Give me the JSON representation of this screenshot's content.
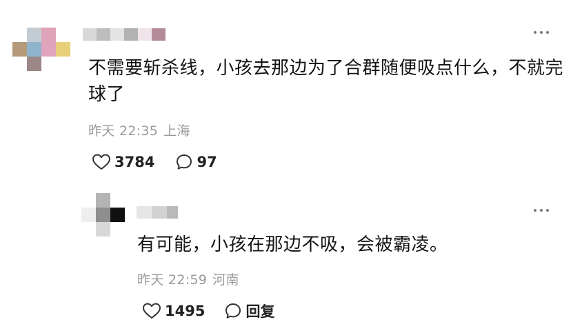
{
  "comment": {
    "text": "不需要斩杀线，小孩去那边为了合群随便吸点什么，不就完球了",
    "time": "昨天 22:35",
    "location": "上海",
    "likes": "3784",
    "replies": "97",
    "like_icon": "heart-outline-icon",
    "reply_icon": "speech-bubble-icon",
    "more_icon": "more-dots-icon"
  },
  "reply": {
    "text": "有可能，小孩在那边不吸，会被霸凌。",
    "time": "昨天 22:59",
    "location": "河南",
    "likes": "1495",
    "reply_label": "回复",
    "like_icon": "heart-outline-icon",
    "reply_icon": "speech-bubble-icon",
    "more_icon": "more-dots-icon"
  },
  "colors": {
    "text": "#141414",
    "meta": "#9a9a9a",
    "icon": "#333333",
    "background": "#ffffff"
  }
}
